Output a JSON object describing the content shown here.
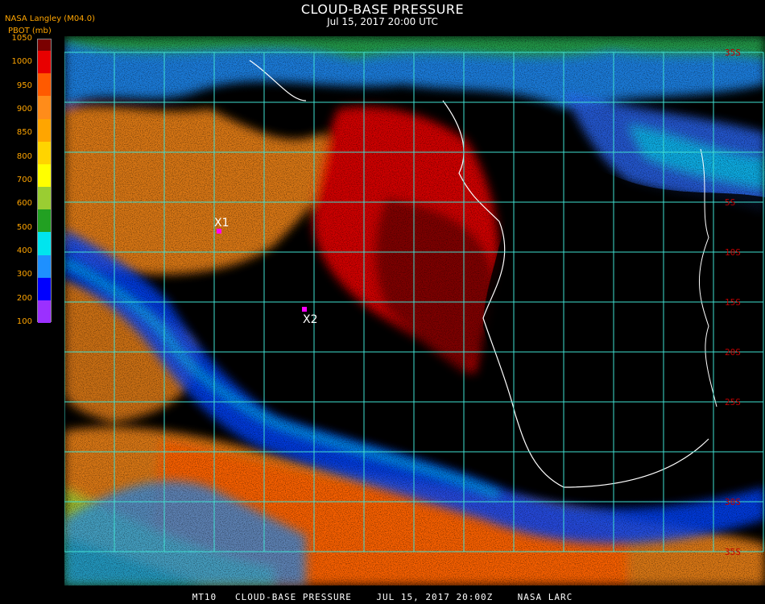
{
  "header": {
    "title": "CLOUD-BASE PRESSURE",
    "subtitle": "Jul 15, 2017 20:00 UTC",
    "source": "NASA Langley (M04.0)",
    "units": "PBOT (mb)"
  },
  "colorbar": {
    "labels": [
      "1050",
      "1000",
      "950",
      "900",
      "850",
      "800",
      "700",
      "600",
      "500",
      "400",
      "300",
      "200",
      "100"
    ],
    "colors": [
      "#7a0000",
      "#e80000",
      "#ff5a00",
      "#ff8c1a",
      "#ffa500",
      "#ffd400",
      "#ffff00",
      "#9acd32",
      "#22a022",
      "#00e5ee",
      "#1e90ff",
      "#0000ff",
      "#9b30ff"
    ]
  },
  "map": {
    "lat_labels": [
      "35S",
      "5S",
      "10S",
      "15S",
      "20S",
      "25S",
      "30S",
      "35S"
    ],
    "points": [
      {
        "label": "X1",
        "color": "#ff00ff"
      },
      {
        "label": "X2",
        "color": "#ff00ff"
      }
    ],
    "grid_color": "#40e0d0"
  },
  "footer": "MT10   CLOUD-BASE PRESSURE    JUL 15, 2017 20:00Z    NASA LARC"
}
